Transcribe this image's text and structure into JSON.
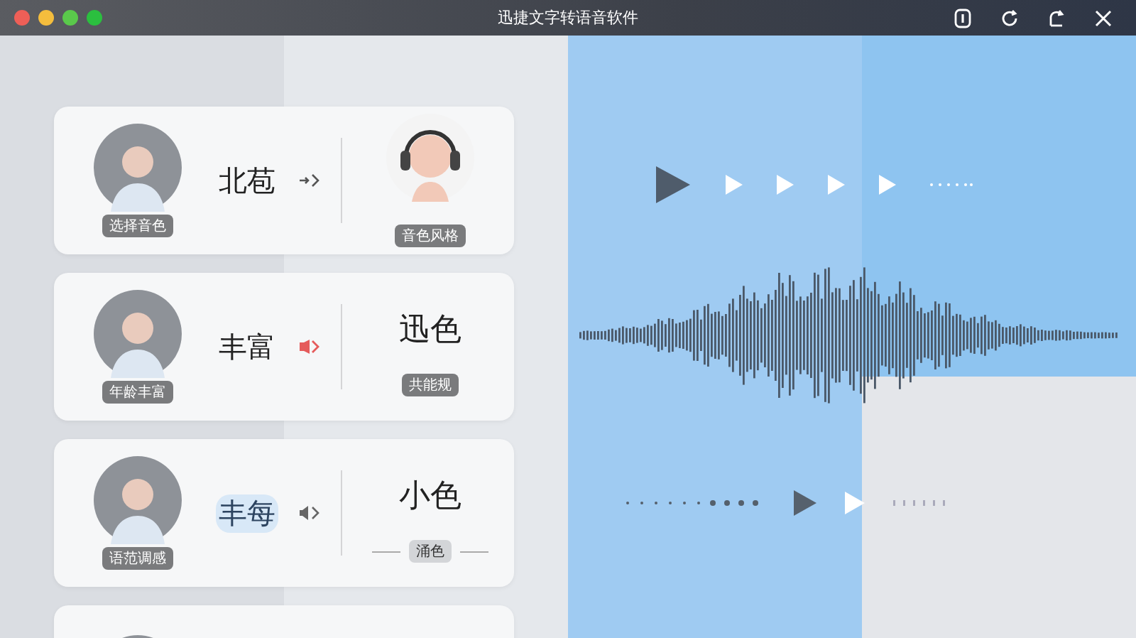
{
  "window": {
    "title": "迅捷文字转语音软件",
    "controls": [
      {
        "color": "#ee5f57"
      },
      {
        "color": "#f4bd3d"
      },
      {
        "color": "#5ac94b"
      },
      {
        "color": "#2bbf3f"
      }
    ]
  },
  "cards": [
    {
      "voice_label": "选择音色",
      "text": "北苞",
      "highlighted": false,
      "arrow": {
        "kind": "plain"
      },
      "target": {
        "kind": "avatar",
        "badge": "音色风格",
        "lined": false
      }
    },
    {
      "voice_label": "年龄丰富",
      "text": "丰富",
      "highlighted": false,
      "arrow": {
        "kind": "red"
      },
      "target": {
        "kind": "text",
        "text": "迅色",
        "badge": "共能规",
        "lined": false
      }
    },
    {
      "voice_label": "语范调感",
      "text": "丰每",
      "highlighted": true,
      "arrow": {
        "kind": "speaker"
      },
      "target": {
        "kind": "text",
        "text": "小色",
        "badge": "涌色",
        "lined": true
      }
    },
    {
      "target": {
        "kind": "none"
      }
    }
  ]
}
